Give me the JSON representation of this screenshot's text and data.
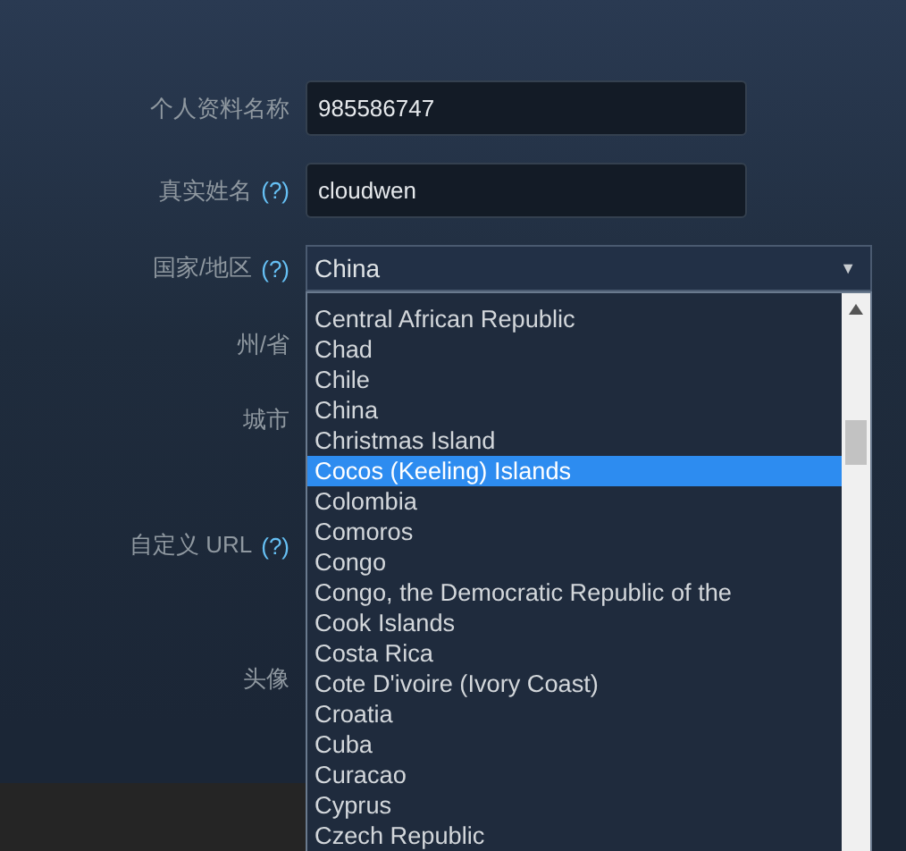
{
  "form": {
    "rows": [
      {
        "kind": "text",
        "label": "个人资料名称",
        "value": "985586747"
      },
      {
        "kind": "text",
        "label": "真实姓名",
        "help": "(?)",
        "value": "cloudwen"
      },
      {
        "kind": "select",
        "label": "国家/地区",
        "help": "(?)",
        "value": "China",
        "arrow": "▼"
      },
      {
        "kind": "hidden",
        "label": "州/省"
      },
      {
        "kind": "hidden",
        "label": "城市"
      },
      {
        "kind": "hidden",
        "label": "自定义 URL",
        "help": "(?)"
      },
      {
        "kind": "hidden",
        "label": "头像"
      }
    ]
  },
  "dropdown": {
    "items": [
      {
        "label": "Central African Republic",
        "selected": false
      },
      {
        "label": "Chad",
        "selected": false
      },
      {
        "label": "Chile",
        "selected": false
      },
      {
        "label": "China",
        "selected": false
      },
      {
        "label": "Christmas Island",
        "selected": false
      },
      {
        "label": "Cocos (Keeling) Islands",
        "selected": true
      },
      {
        "label": "Colombia",
        "selected": false
      },
      {
        "label": "Comoros",
        "selected": false
      },
      {
        "label": "Congo",
        "selected": false
      },
      {
        "label": "Congo, the Democratic Republic of the",
        "selected": false
      },
      {
        "label": "Cook Islands",
        "selected": false
      },
      {
        "label": "Costa Rica",
        "selected": false
      },
      {
        "label": "Cote D'ivoire (Ivory Coast)",
        "selected": false
      },
      {
        "label": "Croatia",
        "selected": false
      },
      {
        "label": "Cuba",
        "selected": false
      },
      {
        "label": "Curacao",
        "selected": false
      },
      {
        "label": "Cyprus",
        "selected": false
      },
      {
        "label": "Czech Republic",
        "selected": false
      }
    ]
  }
}
